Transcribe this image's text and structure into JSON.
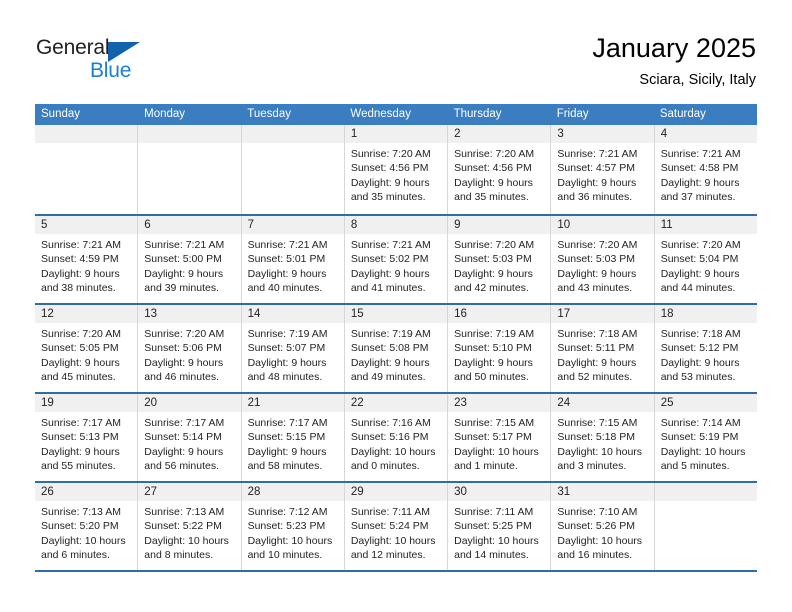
{
  "brand": {
    "name_top": "General",
    "name_bottom": "Blue",
    "triangle_color": "#1263ac",
    "blue_color": "#1b7fd4"
  },
  "header": {
    "title": "January 2025",
    "subtitle": "Sciara, Sicily, Italy"
  },
  "theme": {
    "header_bar": "#3a7dc0",
    "row_divider": "#2f6ca8",
    "daynum_strip": "#f0f0f0",
    "cell_divider": "#d7d7d7"
  },
  "calendar": {
    "weekdays": [
      "Sunday",
      "Monday",
      "Tuesday",
      "Wednesday",
      "Thursday",
      "Friday",
      "Saturday"
    ],
    "weeks": [
      [
        {
          "day": "",
          "sunrise": "",
          "sunset": "",
          "daylight1": "",
          "daylight2": ""
        },
        {
          "day": "",
          "sunrise": "",
          "sunset": "",
          "daylight1": "",
          "daylight2": ""
        },
        {
          "day": "",
          "sunrise": "",
          "sunset": "",
          "daylight1": "",
          "daylight2": ""
        },
        {
          "day": "1",
          "sunrise": "Sunrise: 7:20 AM",
          "sunset": "Sunset: 4:56 PM",
          "daylight1": "Daylight: 9 hours",
          "daylight2": "and 35 minutes."
        },
        {
          "day": "2",
          "sunrise": "Sunrise: 7:20 AM",
          "sunset": "Sunset: 4:56 PM",
          "daylight1": "Daylight: 9 hours",
          "daylight2": "and 35 minutes."
        },
        {
          "day": "3",
          "sunrise": "Sunrise: 7:21 AM",
          "sunset": "Sunset: 4:57 PM",
          "daylight1": "Daylight: 9 hours",
          "daylight2": "and 36 minutes."
        },
        {
          "day": "4",
          "sunrise": "Sunrise: 7:21 AM",
          "sunset": "Sunset: 4:58 PM",
          "daylight1": "Daylight: 9 hours",
          "daylight2": "and 37 minutes."
        }
      ],
      [
        {
          "day": "5",
          "sunrise": "Sunrise: 7:21 AM",
          "sunset": "Sunset: 4:59 PM",
          "daylight1": "Daylight: 9 hours",
          "daylight2": "and 38 minutes."
        },
        {
          "day": "6",
          "sunrise": "Sunrise: 7:21 AM",
          "sunset": "Sunset: 5:00 PM",
          "daylight1": "Daylight: 9 hours",
          "daylight2": "and 39 minutes."
        },
        {
          "day": "7",
          "sunrise": "Sunrise: 7:21 AM",
          "sunset": "Sunset: 5:01 PM",
          "daylight1": "Daylight: 9 hours",
          "daylight2": "and 40 minutes."
        },
        {
          "day": "8",
          "sunrise": "Sunrise: 7:21 AM",
          "sunset": "Sunset: 5:02 PM",
          "daylight1": "Daylight: 9 hours",
          "daylight2": "and 41 minutes."
        },
        {
          "day": "9",
          "sunrise": "Sunrise: 7:20 AM",
          "sunset": "Sunset: 5:03 PM",
          "daylight1": "Daylight: 9 hours",
          "daylight2": "and 42 minutes."
        },
        {
          "day": "10",
          "sunrise": "Sunrise: 7:20 AM",
          "sunset": "Sunset: 5:03 PM",
          "daylight1": "Daylight: 9 hours",
          "daylight2": "and 43 minutes."
        },
        {
          "day": "11",
          "sunrise": "Sunrise: 7:20 AM",
          "sunset": "Sunset: 5:04 PM",
          "daylight1": "Daylight: 9 hours",
          "daylight2": "and 44 minutes."
        }
      ],
      [
        {
          "day": "12",
          "sunrise": "Sunrise: 7:20 AM",
          "sunset": "Sunset: 5:05 PM",
          "daylight1": "Daylight: 9 hours",
          "daylight2": "and 45 minutes."
        },
        {
          "day": "13",
          "sunrise": "Sunrise: 7:20 AM",
          "sunset": "Sunset: 5:06 PM",
          "daylight1": "Daylight: 9 hours",
          "daylight2": "and 46 minutes."
        },
        {
          "day": "14",
          "sunrise": "Sunrise: 7:19 AM",
          "sunset": "Sunset: 5:07 PM",
          "daylight1": "Daylight: 9 hours",
          "daylight2": "and 48 minutes."
        },
        {
          "day": "15",
          "sunrise": "Sunrise: 7:19 AM",
          "sunset": "Sunset: 5:08 PM",
          "daylight1": "Daylight: 9 hours",
          "daylight2": "and 49 minutes."
        },
        {
          "day": "16",
          "sunrise": "Sunrise: 7:19 AM",
          "sunset": "Sunset: 5:10 PM",
          "daylight1": "Daylight: 9 hours",
          "daylight2": "and 50 minutes."
        },
        {
          "day": "17",
          "sunrise": "Sunrise: 7:18 AM",
          "sunset": "Sunset: 5:11 PM",
          "daylight1": "Daylight: 9 hours",
          "daylight2": "and 52 minutes."
        },
        {
          "day": "18",
          "sunrise": "Sunrise: 7:18 AM",
          "sunset": "Sunset: 5:12 PM",
          "daylight1": "Daylight: 9 hours",
          "daylight2": "and 53 minutes."
        }
      ],
      [
        {
          "day": "19",
          "sunrise": "Sunrise: 7:17 AM",
          "sunset": "Sunset: 5:13 PM",
          "daylight1": "Daylight: 9 hours",
          "daylight2": "and 55 minutes."
        },
        {
          "day": "20",
          "sunrise": "Sunrise: 7:17 AM",
          "sunset": "Sunset: 5:14 PM",
          "daylight1": "Daylight: 9 hours",
          "daylight2": "and 56 minutes."
        },
        {
          "day": "21",
          "sunrise": "Sunrise: 7:17 AM",
          "sunset": "Sunset: 5:15 PM",
          "daylight1": "Daylight: 9 hours",
          "daylight2": "and 58 minutes."
        },
        {
          "day": "22",
          "sunrise": "Sunrise: 7:16 AM",
          "sunset": "Sunset: 5:16 PM",
          "daylight1": "Daylight: 10 hours",
          "daylight2": "and 0 minutes."
        },
        {
          "day": "23",
          "sunrise": "Sunrise: 7:15 AM",
          "sunset": "Sunset: 5:17 PM",
          "daylight1": "Daylight: 10 hours",
          "daylight2": "and 1 minute."
        },
        {
          "day": "24",
          "sunrise": "Sunrise: 7:15 AM",
          "sunset": "Sunset: 5:18 PM",
          "daylight1": "Daylight: 10 hours",
          "daylight2": "and 3 minutes."
        },
        {
          "day": "25",
          "sunrise": "Sunrise: 7:14 AM",
          "sunset": "Sunset: 5:19 PM",
          "daylight1": "Daylight: 10 hours",
          "daylight2": "and 5 minutes."
        }
      ],
      [
        {
          "day": "26",
          "sunrise": "Sunrise: 7:13 AM",
          "sunset": "Sunset: 5:20 PM",
          "daylight1": "Daylight: 10 hours",
          "daylight2": "and 6 minutes."
        },
        {
          "day": "27",
          "sunrise": "Sunrise: 7:13 AM",
          "sunset": "Sunset: 5:22 PM",
          "daylight1": "Daylight: 10 hours",
          "daylight2": "and 8 minutes."
        },
        {
          "day": "28",
          "sunrise": "Sunrise: 7:12 AM",
          "sunset": "Sunset: 5:23 PM",
          "daylight1": "Daylight: 10 hours",
          "daylight2": "and 10 minutes."
        },
        {
          "day": "29",
          "sunrise": "Sunrise: 7:11 AM",
          "sunset": "Sunset: 5:24 PM",
          "daylight1": "Daylight: 10 hours",
          "daylight2": "and 12 minutes."
        },
        {
          "day": "30",
          "sunrise": "Sunrise: 7:11 AM",
          "sunset": "Sunset: 5:25 PM",
          "daylight1": "Daylight: 10 hours",
          "daylight2": "and 14 minutes."
        },
        {
          "day": "31",
          "sunrise": "Sunrise: 7:10 AM",
          "sunset": "Sunset: 5:26 PM",
          "daylight1": "Daylight: 10 hours",
          "daylight2": "and 16 minutes."
        },
        {
          "day": "",
          "sunrise": "",
          "sunset": "",
          "daylight1": "",
          "daylight2": ""
        }
      ]
    ]
  }
}
